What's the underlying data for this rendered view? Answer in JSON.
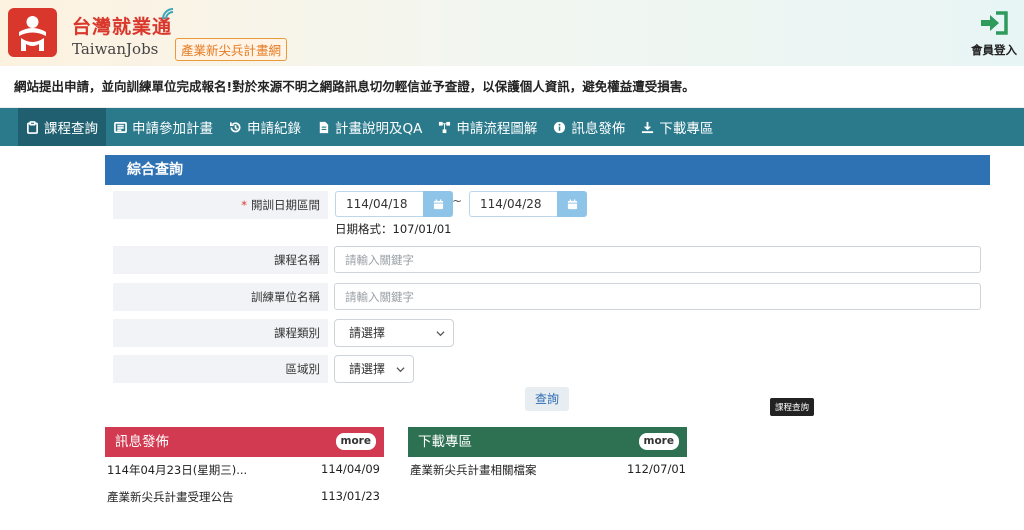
{
  "header": {
    "brand_title": "台灣就業通",
    "brand_subtitle": "TaiwanJobs",
    "brand_badge": "產業新尖兵計畫網",
    "login_label": "會員登入"
  },
  "marquee_text": "網站提出申請，並向訓練單位完成報名!對於來源不明之網路訊息切勿輕信並予查證，以保護個人資訊，避免權益遭受損害。",
  "nav": {
    "items": [
      {
        "label": "課程查詢",
        "icon": "clipboard-icon"
      },
      {
        "label": "申請參加計畫",
        "icon": "form-icon"
      },
      {
        "label": "申請紀錄",
        "icon": "history-icon"
      },
      {
        "label": "計畫說明及QA",
        "icon": "document-icon"
      },
      {
        "label": "申請流程圖解",
        "icon": "flowchart-icon"
      },
      {
        "label": "訊息發佈",
        "icon": "info-icon"
      },
      {
        "label": "下載專區",
        "icon": "download-icon"
      }
    ]
  },
  "search": {
    "title": "綜合查詢",
    "date_label": "開訓日期區間",
    "date_required_mark": "*",
    "date_from": "114/04/18",
    "date_to": "114/04/28",
    "date_separator": "~",
    "date_hint": "日期格式：107/01/01",
    "course_name_label": "課程名稱",
    "course_name_placeholder": "請輸入關鍵字",
    "trainer_label": "訓練單位名稱",
    "trainer_placeholder": "請輸入關鍵字",
    "category_label": "課程類別",
    "category_value": "請選擇",
    "region_label": "區域別",
    "region_value": "請選擇",
    "search_button": "查詢",
    "tooltip": "課程查詢"
  },
  "news": {
    "title": "訊息發佈",
    "more": "more",
    "items": [
      {
        "title": "114年04月23日(星期三)...",
        "date": "114/04/09"
      },
      {
        "title": "產業新尖兵計畫受理公告",
        "date": "113/01/23"
      }
    ]
  },
  "downloads": {
    "title": "下載專區",
    "more": "more",
    "items": [
      {
        "title": "產業新尖兵計畫相關檔案",
        "date": "112/07/01"
      }
    ]
  },
  "colors": {
    "brand_red": "#d9372c",
    "nav_teal": "#2a7a8c",
    "panel_blue": "#2f72b3",
    "news_red": "#d23a51",
    "download_green": "#2e7152",
    "login_green": "#2e9a5c"
  }
}
